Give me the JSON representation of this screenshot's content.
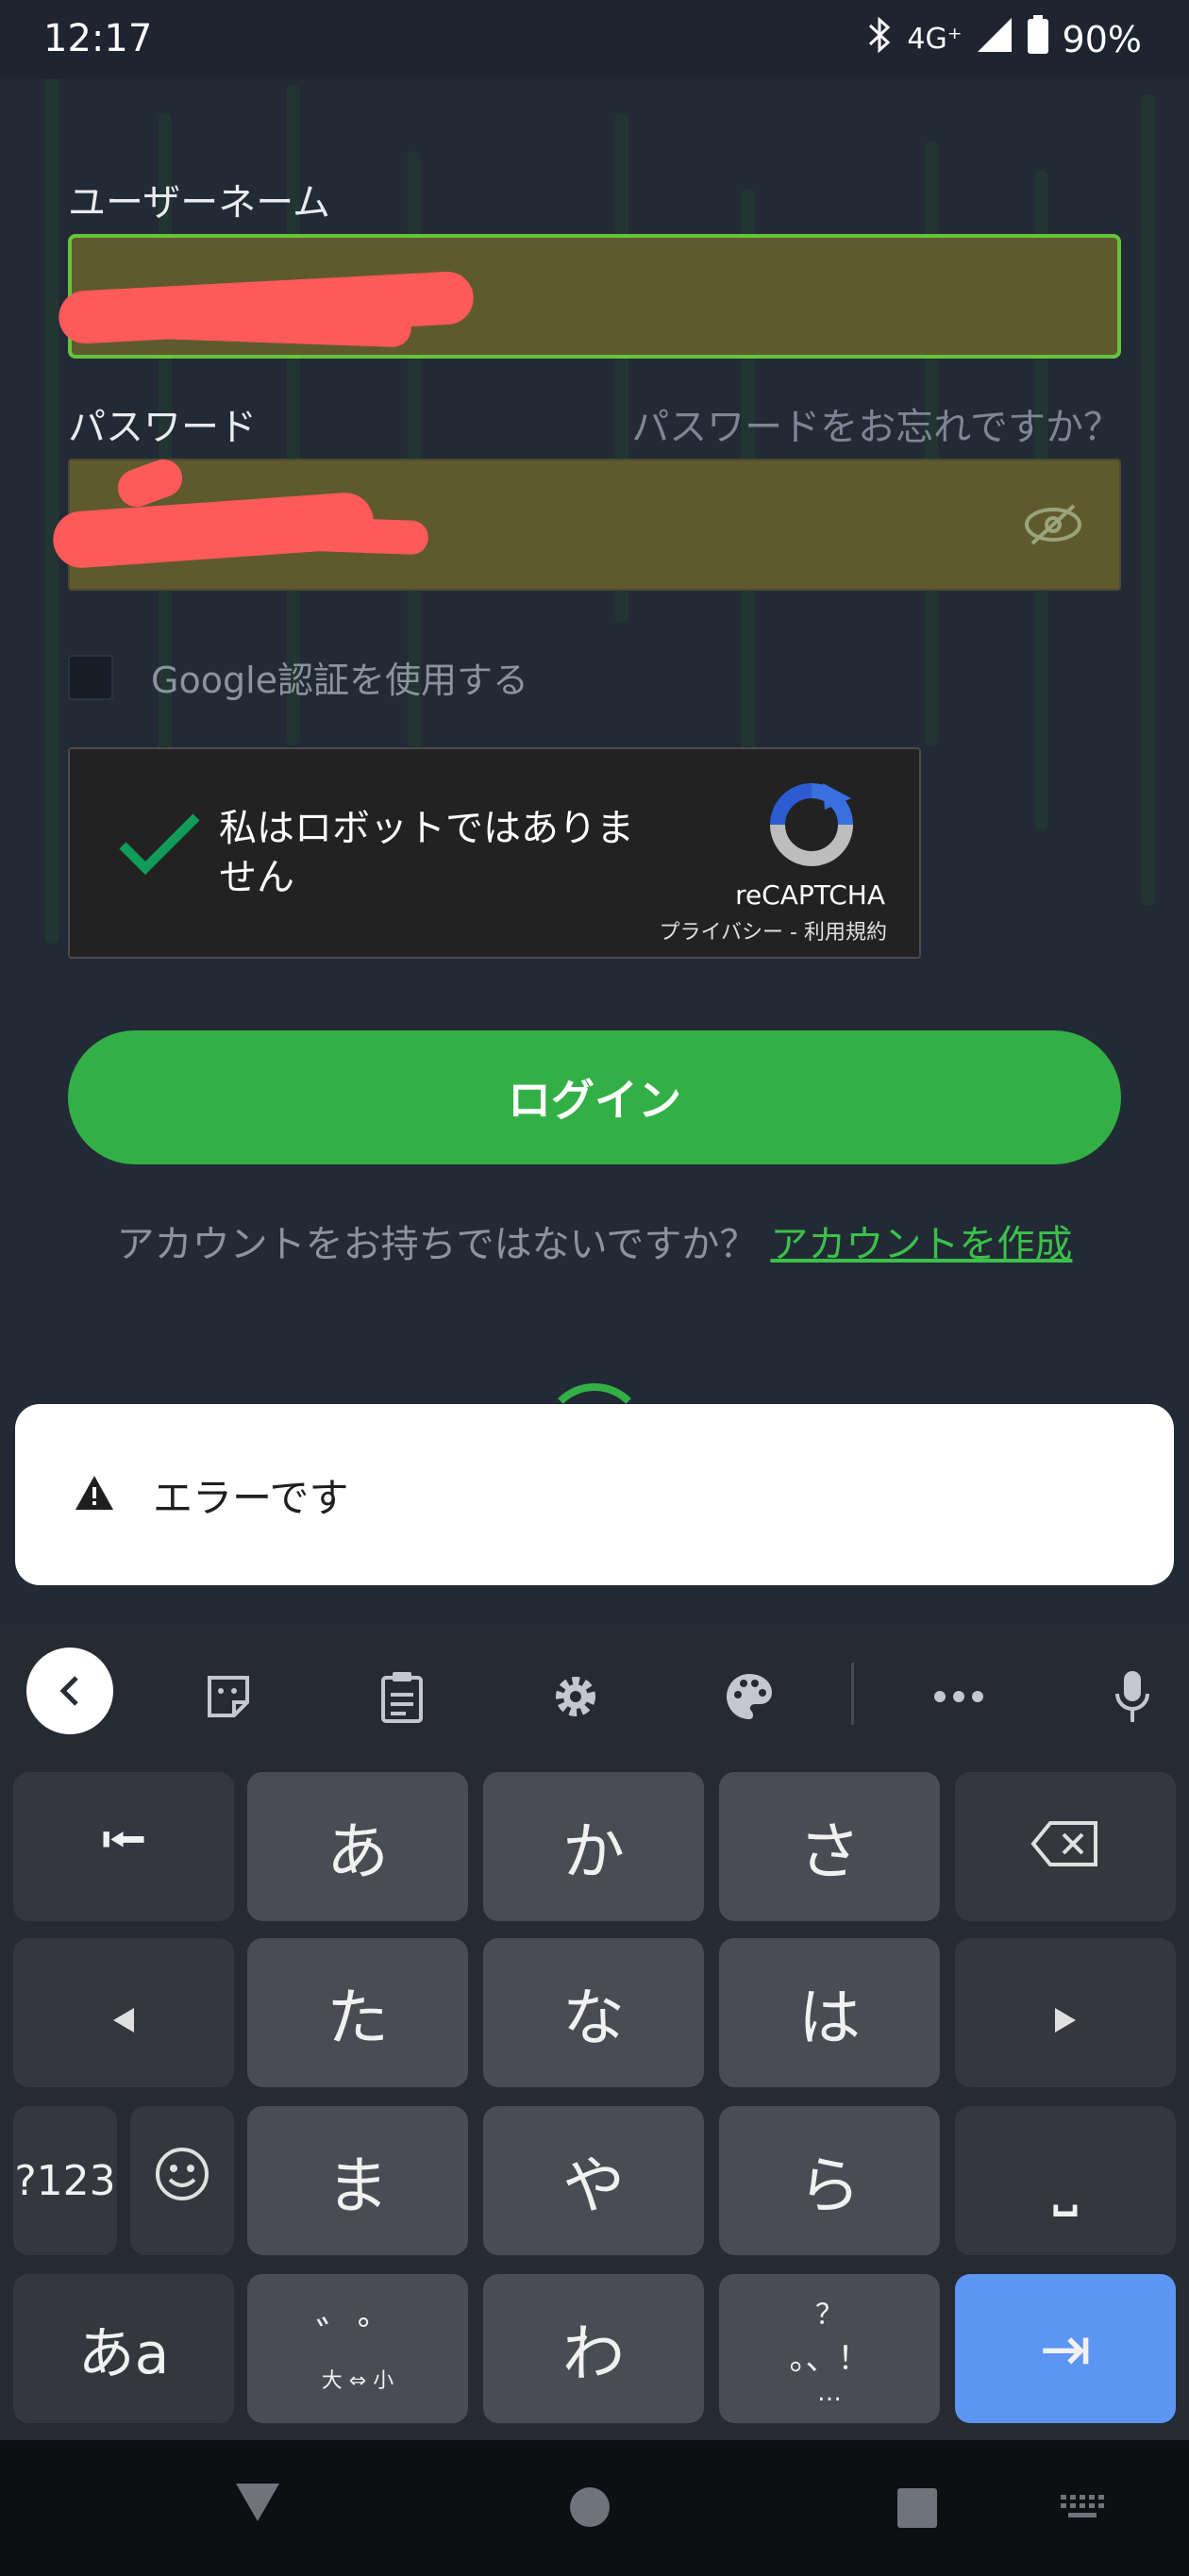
{
  "status_bar": {
    "time": "12:17",
    "network": "4G⁺",
    "battery": "90%"
  },
  "form": {
    "username_label": "ユーザーネーム",
    "password_label": "パスワード",
    "forgot_password": "パスワードをお忘れですか？",
    "google_auth_label": "Google認証を使用する",
    "recaptcha": {
      "text": "私はロボットではありません",
      "brand": "reCAPTCHA",
      "terms": "プライバシー - 利用規約"
    },
    "login_button": "ログイン",
    "no_account": "アカウントをお持ちではないですか？",
    "create_account": "アカウントを作成"
  },
  "toast": {
    "message": "エラーです"
  },
  "keyboard": {
    "keys": {
      "back_tab": "⭰",
      "a": "あ",
      "ka": "か",
      "sa": "さ",
      "ta": "た",
      "na": "な",
      "ha": "は",
      "ma": "ま",
      "ya": "や",
      "ra": "ら",
      "wa": "わ",
      "sym": "?123",
      "space": "⎵",
      "ime": "あa",
      "dakuten": "゛゜",
      "dakuten_sub": "大 ⇔ 小",
      "punct_top": "？",
      "punct_mid": "。、！",
      "punct_bottom": "…",
      "enter": "⇥"
    }
  },
  "colors": {
    "accent_green": "#33b045",
    "link_green": "#3bc14a",
    "field_fill": "#5f5a2e",
    "enter_blue": "#5c95f2",
    "background": "#222a36"
  }
}
